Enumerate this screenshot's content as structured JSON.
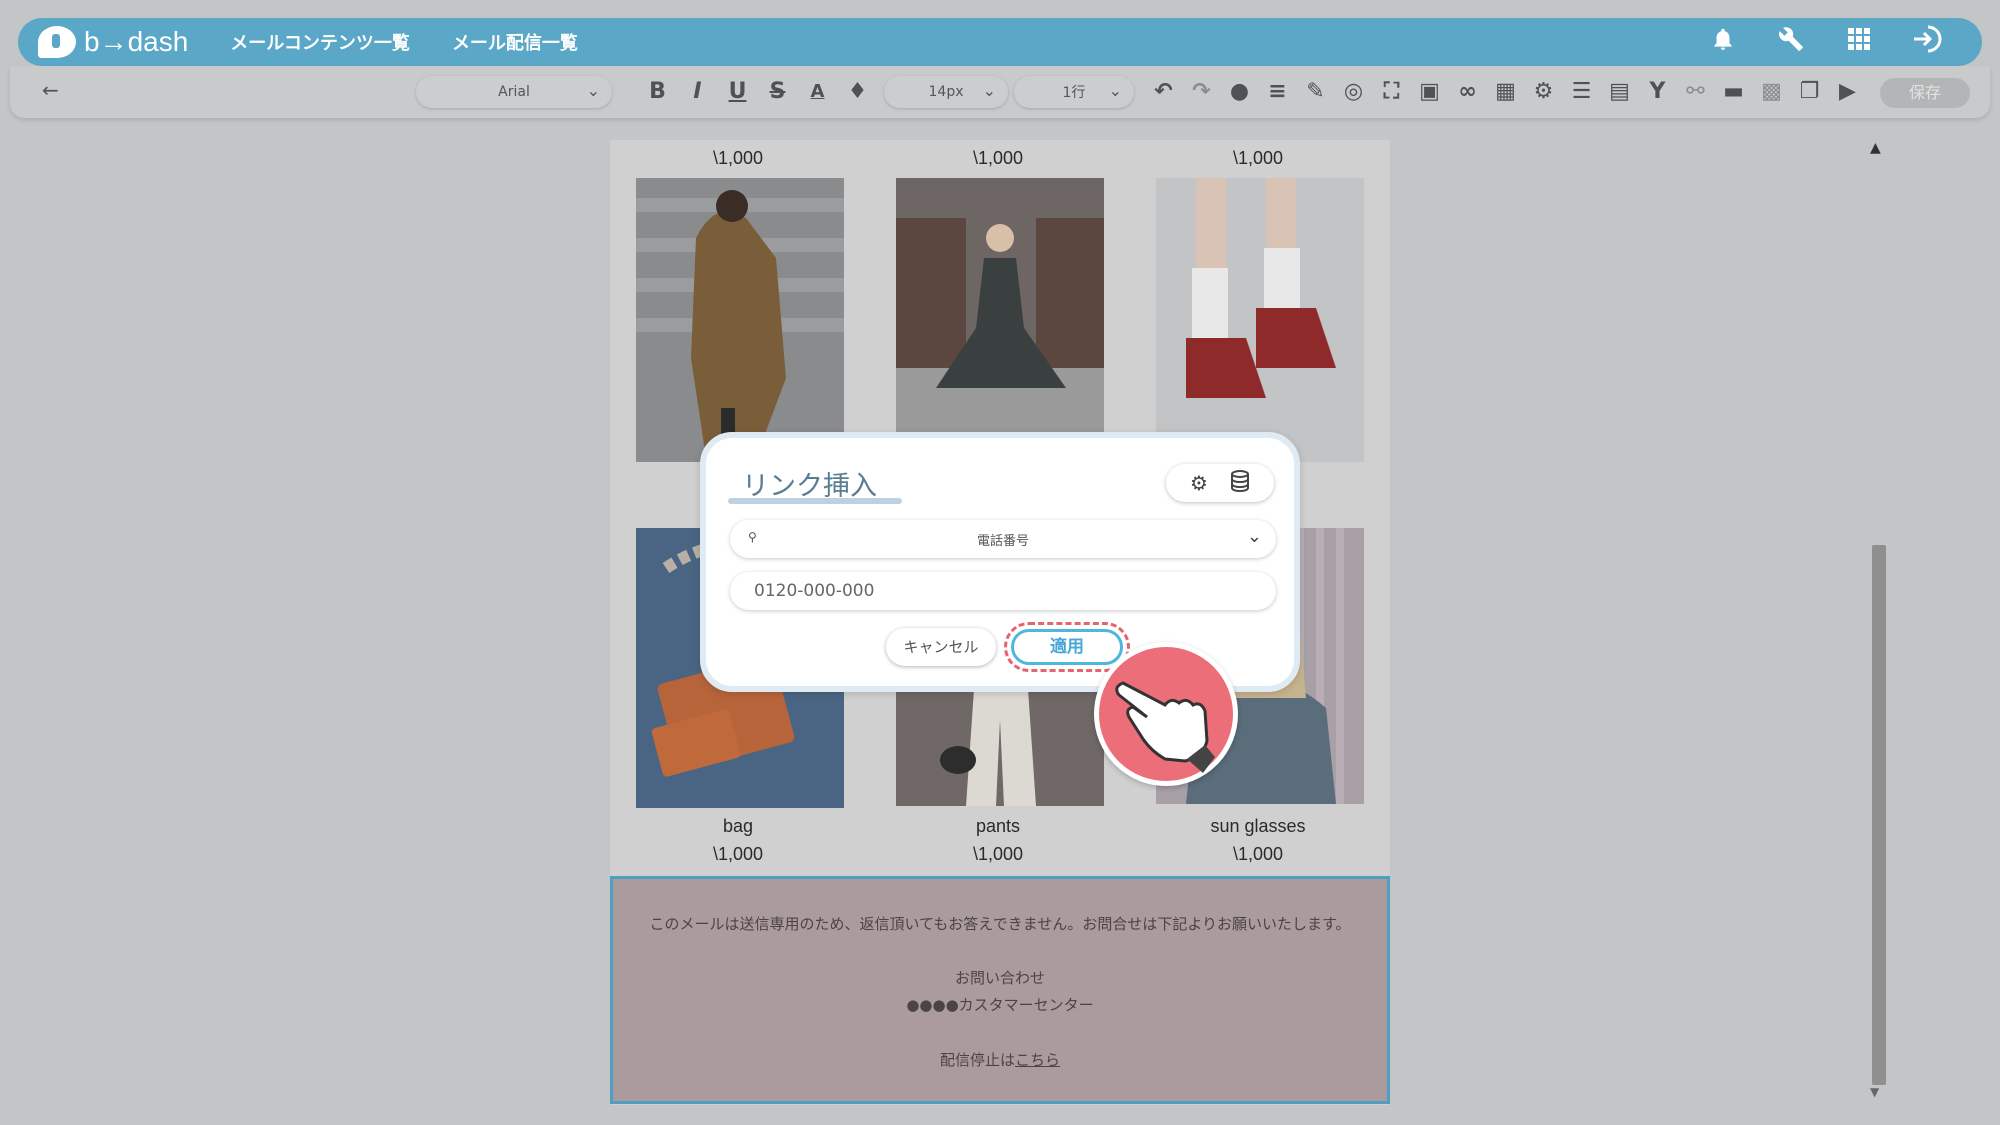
{
  "header": {
    "logo_text": "b→dash",
    "nav": [
      "メールコンテンツ一覧",
      "メール配信一覧"
    ],
    "icons": [
      "bell-icon",
      "wrench-icon",
      "grid-icon",
      "logout-icon"
    ]
  },
  "toolbar": {
    "back_icon": "←",
    "font": "Arial",
    "font_size": "14px",
    "line_height": "1行",
    "save_label": "保存",
    "format_icons": [
      "bold-icon",
      "italic-icon",
      "underline-icon",
      "strikethrough-icon",
      "font-color-icon",
      "highlight-icon"
    ],
    "action_icons": [
      "undo-icon",
      "redo-icon",
      "palette-icon",
      "align-icon",
      "pen-icon",
      "target-icon",
      "fullscreen-icon",
      "image-icon",
      "link-icon",
      "calendar-icon",
      "gears-icon",
      "database-icon",
      "note-icon",
      "branch-icon",
      "link-setting-icon",
      "divider-icon",
      "person-icon",
      "template-icon",
      "video-icon"
    ]
  },
  "products": {
    "top_prices": [
      "\\1,000",
      "\\1,000",
      "\\1,000"
    ],
    "bottom_names": [
      "bag",
      "pants",
      "sun glasses"
    ],
    "bottom_prices": [
      "\\1,000",
      "\\1,000",
      "\\1,000"
    ]
  },
  "footer": {
    "notice": "このメールは送信専用のため、返信頂いてもお答えできません。お問合せは下記よりお願いいたします。",
    "contact_label": "お問い合わせ",
    "center_name": "●●●●カスタマーセンター",
    "unsubscribe_prefix": "配信停止は",
    "unsubscribe_link": "こちら"
  },
  "modal": {
    "title": "リンク挿入",
    "link_type": "電話番号",
    "phone_value": "0120-000-000",
    "cancel_label": "キャンセル",
    "apply_label": "適用"
  },
  "colors": {
    "header": "#5aa7c7",
    "accent_blue": "#4fb6dd",
    "highlight_red": "#e56471",
    "footer_bg": "#ab9b9c"
  }
}
